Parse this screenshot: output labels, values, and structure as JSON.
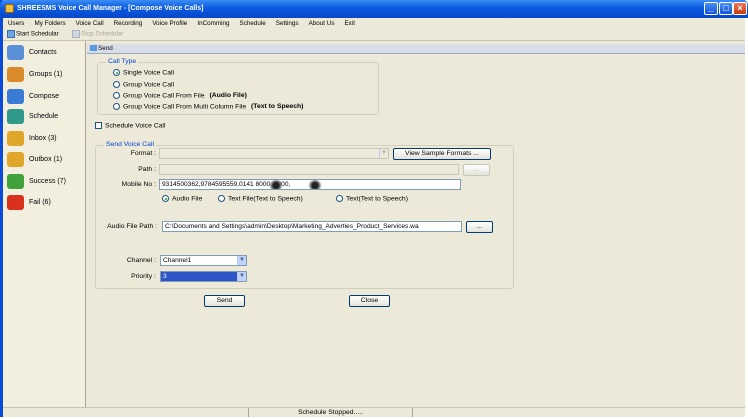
{
  "window": {
    "title": "SHREESMS Voice Call Manager - [Compose Voice Calls]",
    "controls": [
      "minimize",
      "maximize",
      "close"
    ]
  },
  "menu": [
    "Users",
    "My Folders",
    "Voice Call",
    "Recording",
    "Voice Profile",
    "InComming",
    "Schedule",
    "Settings",
    "About Us",
    "Exit"
  ],
  "toolbar": {
    "start_scheduler": "Start Schedular",
    "stop_scheduler": "Stop Schedular"
  },
  "sidebar": {
    "items": [
      {
        "label": "Contacts",
        "icon": "contacts-icon",
        "color": "#5b8fd6"
      },
      {
        "label": "Groups (1)",
        "icon": "groups-icon",
        "color": "#d98b2b"
      },
      {
        "label": "Compose",
        "icon": "compose-icon",
        "color": "#3a7bd5"
      },
      {
        "label": "Schedule",
        "icon": "schedule-icon",
        "color": "#2f9a8a"
      },
      {
        "label": "Inbox (3)",
        "icon": "inbox-icon",
        "color": "#e0a62a"
      },
      {
        "label": "Outbox (1)",
        "icon": "outbox-icon",
        "color": "#e0a62a"
      },
      {
        "label": "Success (7)",
        "icon": "success-icon",
        "color": "#3fa23a"
      },
      {
        "label": "Fail (6)",
        "icon": "fail-icon",
        "color": "#d8321c"
      }
    ]
  },
  "tab": {
    "label": "Send"
  },
  "call_type": {
    "title": "Call Type",
    "options": [
      {
        "label": "Single Voice Call",
        "note": "",
        "selected": true
      },
      {
        "label": "Group Voice Call",
        "note": "",
        "selected": false
      },
      {
        "label": "Group Voice Call From File",
        "note": "(Audio File)",
        "selected": false
      },
      {
        "label": "Group Voice Call From Multi Column File",
        "note": "(Text to Speech)",
        "selected": false
      }
    ]
  },
  "schedule_checkbox": {
    "label": "Schedule Voice Call",
    "checked": false
  },
  "send_voice_call": {
    "title": "Send Voice Call",
    "format_label": "Format :",
    "format_value": "",
    "view_formats_button": "View Sample Formats ...",
    "path_label": "Path :",
    "path_value": "",
    "path_browse": "...",
    "mobile_label": "Mobile No :",
    "mobile_value": "9314500362,9784595559,0141 8000, 0000,",
    "source_options": [
      {
        "label": "Audio File",
        "selected": true
      },
      {
        "label": "Text File(Text to Speech)",
        "selected": false
      },
      {
        "label": "Text(Text to Speech)",
        "selected": false
      }
    ],
    "audio_path_label": "Audio File Path :",
    "audio_path_value": "C:\\Documents and Settings\\admin\\Desktop\\Marketing_Adverties_Product_Services.wa",
    "audio_browse": "...",
    "channel_label": "Channel :",
    "channel_value": "Channel1",
    "priority_label": "Priority :",
    "priority_value": "3"
  },
  "actions": {
    "send": "Send",
    "close": "Close"
  },
  "status": {
    "text": "Schedule Stopped....."
  }
}
